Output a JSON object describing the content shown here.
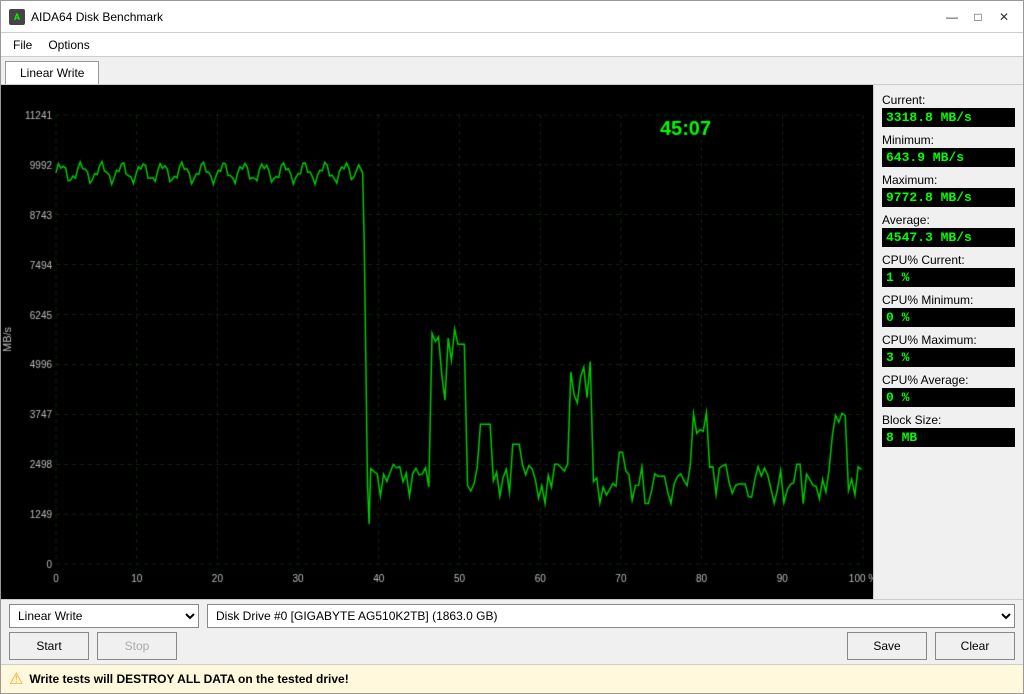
{
  "window": {
    "title": "AIDA64 Disk Benchmark",
    "icon_label": "A"
  },
  "menu": {
    "items": [
      "File",
      "Options"
    ]
  },
  "tab": {
    "label": "Linear Write"
  },
  "chart": {
    "timer": "45:07",
    "y_axis_label": "MB/s",
    "y_ticks": [
      "11241",
      "9992",
      "8743",
      "7494",
      "6245",
      "4996",
      "3747",
      "2498",
      "1249",
      "0"
    ],
    "x_ticks": [
      "0",
      "10",
      "20",
      "30",
      "40",
      "50",
      "60",
      "70",
      "80",
      "90",
      "100 %"
    ]
  },
  "stats": {
    "current_label": "Current:",
    "current_value": "3318.8 MB/s",
    "minimum_label": "Minimum:",
    "minimum_value": "643.9 MB/s",
    "maximum_label": "Maximum:",
    "maximum_value": "9772.8 MB/s",
    "average_label": "Average:",
    "average_value": "4547.3 MB/s",
    "cpu_current_label": "CPU% Current:",
    "cpu_current_value": "1 %",
    "cpu_minimum_label": "CPU% Minimum:",
    "cpu_minimum_value": "0 %",
    "cpu_maximum_label": "CPU% Maximum:",
    "cpu_maximum_value": "3 %",
    "cpu_average_label": "CPU% Average:",
    "cpu_average_value": "0 %",
    "block_size_label": "Block Size:",
    "block_size_value": "8 MB"
  },
  "bottom": {
    "test_type_label": "Linear Write",
    "drive_label": "Disk Drive #0  [GIGABYTE AG510K2TB]  (1863.0 GB)",
    "start_label": "Start",
    "stop_label": "Stop",
    "save_label": "Save",
    "clear_label": "Clear"
  },
  "warning": {
    "text": "Write tests will DESTROY ALL DATA on the tested drive!"
  },
  "title_buttons": {
    "minimize": "—",
    "maximize": "□",
    "close": "✕"
  }
}
